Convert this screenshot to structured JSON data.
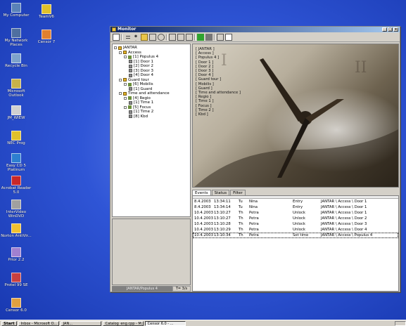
{
  "desktop": {
    "icons_col1": [
      {
        "label": "My Computer",
        "icon": "computer-icon"
      },
      {
        "label": "My Network Places",
        "icon": "network-icon"
      },
      {
        "label": "Recycle Bin",
        "icon": "recycle-bin-icon"
      },
      {
        "label": "Microsoft Outlook",
        "icon": "outlook-icon"
      },
      {
        "label": "JM_WIEW",
        "icon": "app-icon"
      },
      {
        "label": "NEC Prog",
        "icon": "pen-icon"
      },
      {
        "label": "Easy CD 5 Platinum",
        "icon": "cd-icon"
      },
      {
        "label": "Acrobat Reader 5.0",
        "icon": "acrobat-icon"
      },
      {
        "label": "InterVideo WinDVD",
        "icon": "dvd-icon"
      },
      {
        "label": "Norton AntiVir...",
        "icon": "norton-icon"
      },
      {
        "label": "Prior 2.2",
        "icon": "app-icon"
      },
      {
        "label": "Protel 99 SE",
        "icon": "protel-icon"
      },
      {
        "label": "Censor 6.0",
        "icon": "censor-icon"
      }
    ],
    "icons_col2": [
      {
        "label": "TeamV6",
        "icon": "app-icon"
      },
      {
        "label": "Censor 7",
        "icon": "censor-icon"
      }
    ]
  },
  "window": {
    "title": "Monitor",
    "controls": [
      "_",
      "□",
      "×"
    ]
  },
  "tree": [
    {
      "label": "JANTAR",
      "level": 0,
      "icon": "home"
    },
    {
      "label": "Access",
      "level": 1,
      "icon": "home"
    },
    {
      "label": "[1] Populus 4",
      "level": 2,
      "icon": "grp"
    },
    {
      "label": "[1] Door 1",
      "level": 3,
      "icon": "door"
    },
    {
      "label": "[2] Door 2",
      "level": 3,
      "icon": "door"
    },
    {
      "label": "[3] Door 3",
      "level": 3,
      "icon": "door"
    },
    {
      "label": "[4] Door 4",
      "level": 3,
      "icon": "door"
    },
    {
      "label": "Guard tour",
      "level": 1,
      "icon": "home"
    },
    {
      "label": "[6] Mobilis",
      "level": 2,
      "icon": "grp"
    },
    {
      "label": "[1] Guard",
      "level": 3,
      "icon": "door"
    },
    {
      "label": "Time and attendance",
      "level": 1,
      "icon": "home"
    },
    {
      "label": "[4] Regio",
      "level": 2,
      "icon": "grp"
    },
    {
      "label": "[1] Time 1",
      "level": 3,
      "icon": "door"
    },
    {
      "label": "[5] Focus",
      "level": 2,
      "icon": "grp"
    },
    {
      "label": "[1] Time 2",
      "level": 3,
      "icon": "door"
    },
    {
      "label": "[8] Kbd",
      "level": 3,
      "icon": "door"
    }
  ],
  "overlay_labels": [
    "[ JANTAR ]",
    "[ Access ]",
    "[ Populus 4 ]",
    "[ Door 1 ]",
    "[ Door 2 ]",
    "[ Door 3 ]",
    "[ Door 4 ]",
    "[ Guard tour ]",
    "[ Mobilis ]",
    "[ Guard ]",
    "[ Time and attendance ]",
    "[ Regio ]",
    "[ Time 1 ]",
    "[ Focus ]",
    "[ Time 2 ]",
    "[ Kbd ]"
  ],
  "status_left": {
    "panel": "JANTAR/Populus 4",
    "value": "T= 3/s"
  },
  "tabs": [
    "Events",
    "Status",
    "Filter"
  ],
  "events": [
    {
      "date": "8.4.2003",
      "time": "13:34:11",
      "day": "Tu",
      "user": "Nina",
      "action": "Entry",
      "path": "JANTAR \\ Access \\ Door 1"
    },
    {
      "date": "8.4.2003",
      "time": "13:34:14",
      "day": "Tu",
      "user": "Nina",
      "action": "Entry",
      "path": "JANTAR \\ Access \\ Door 1"
    },
    {
      "date": "10.4.2003",
      "time": "13:10:27",
      "day": "Th",
      "user": "Petra",
      "action": "Unlock",
      "path": "JANTAR \\ Access \\ Door 1"
    },
    {
      "date": "10.4.2003",
      "time": "13:10:27",
      "day": "Th",
      "user": "Petra",
      "action": "Unlock",
      "path": "JANTAR \\ Access \\ Door 2"
    },
    {
      "date": "10.4.2003",
      "time": "13:10:28",
      "day": "Th",
      "user": "Petra",
      "action": "Unlock",
      "path": "JANTAR \\ Access \\ Door 3"
    },
    {
      "date": "10.4.2003",
      "time": "13:10:29",
      "day": "Th",
      "user": "Petra",
      "action": "Unlock",
      "path": "JANTAR \\ Access \\ Door 4"
    },
    {
      "date": "10.4.2003",
      "time": "13:10:34",
      "day": "Th",
      "user": "Petra",
      "action": "Set time",
      "path": "JANTAR \\ Access \\ Populus 4"
    }
  ],
  "taskbar": {
    "start": "Start",
    "tasks": [
      "Inbox - Microsoft O...",
      "JAN...",
      "Catalog_eng.cpp - M...",
      "Censor 6.0 - ..."
    ]
  }
}
